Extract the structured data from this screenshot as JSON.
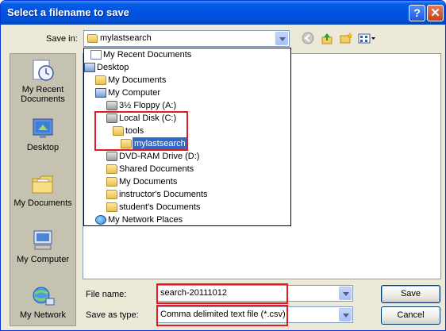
{
  "window": {
    "title": "Select a filename to save",
    "help_glyph": "?",
    "close_glyph": "✕"
  },
  "save_in": {
    "label": "Save in:",
    "value": "mylastsearch"
  },
  "toolbar": {
    "back_icon": "back-arrow-icon",
    "up_icon": "up-folder-icon",
    "new_folder_icon": "new-folder-icon",
    "views_icon": "views-menu-icon"
  },
  "places": [
    {
      "label": "My Recent Documents",
      "icon": "recent-documents-icon"
    },
    {
      "label": "Desktop",
      "icon": "desktop-icon"
    },
    {
      "label": "My Documents",
      "icon": "my-documents-icon"
    },
    {
      "label": "My Computer",
      "icon": "my-computer-icon"
    },
    {
      "label": "My Network",
      "icon": "network-icon"
    }
  ],
  "dropdown": {
    "items": [
      {
        "label": "My Recent Documents",
        "icon": "recent-documents-icon"
      },
      {
        "label": "Desktop",
        "icon": "desktop-icon"
      },
      {
        "label": "My Documents",
        "icon": "folder-icon"
      },
      {
        "label": "My Computer",
        "icon": "computer-icon"
      },
      {
        "label": "3½ Floppy (A:)",
        "icon": "floppy-drive-icon"
      },
      {
        "label": "Local Disk (C:)",
        "icon": "hard-drive-icon"
      },
      {
        "label": "tools",
        "icon": "folder-icon"
      },
      {
        "label": "mylastsearch",
        "icon": "folder-icon",
        "selected": true
      },
      {
        "label": "DVD-RAM Drive (D:)",
        "icon": "dvd-drive-icon"
      },
      {
        "label": "Shared Documents",
        "icon": "folder-icon"
      },
      {
        "label": "My Documents",
        "icon": "folder-icon"
      },
      {
        "label": "instructor's Documents",
        "icon": "folder-icon"
      },
      {
        "label": "student's Documents",
        "icon": "folder-icon"
      },
      {
        "label": "My Network Places",
        "icon": "network-places-icon"
      }
    ]
  },
  "file_name": {
    "label": "File name:",
    "value": "search-20111012"
  },
  "save_as_type": {
    "label": "Save as type:",
    "value": "Comma delimited text file (*.csv)"
  },
  "buttons": {
    "save": "Save",
    "cancel": "Cancel"
  },
  "colors": {
    "highlight": "#e01b24",
    "selection": "#316ac5",
    "titlebar": "#0054e3"
  }
}
